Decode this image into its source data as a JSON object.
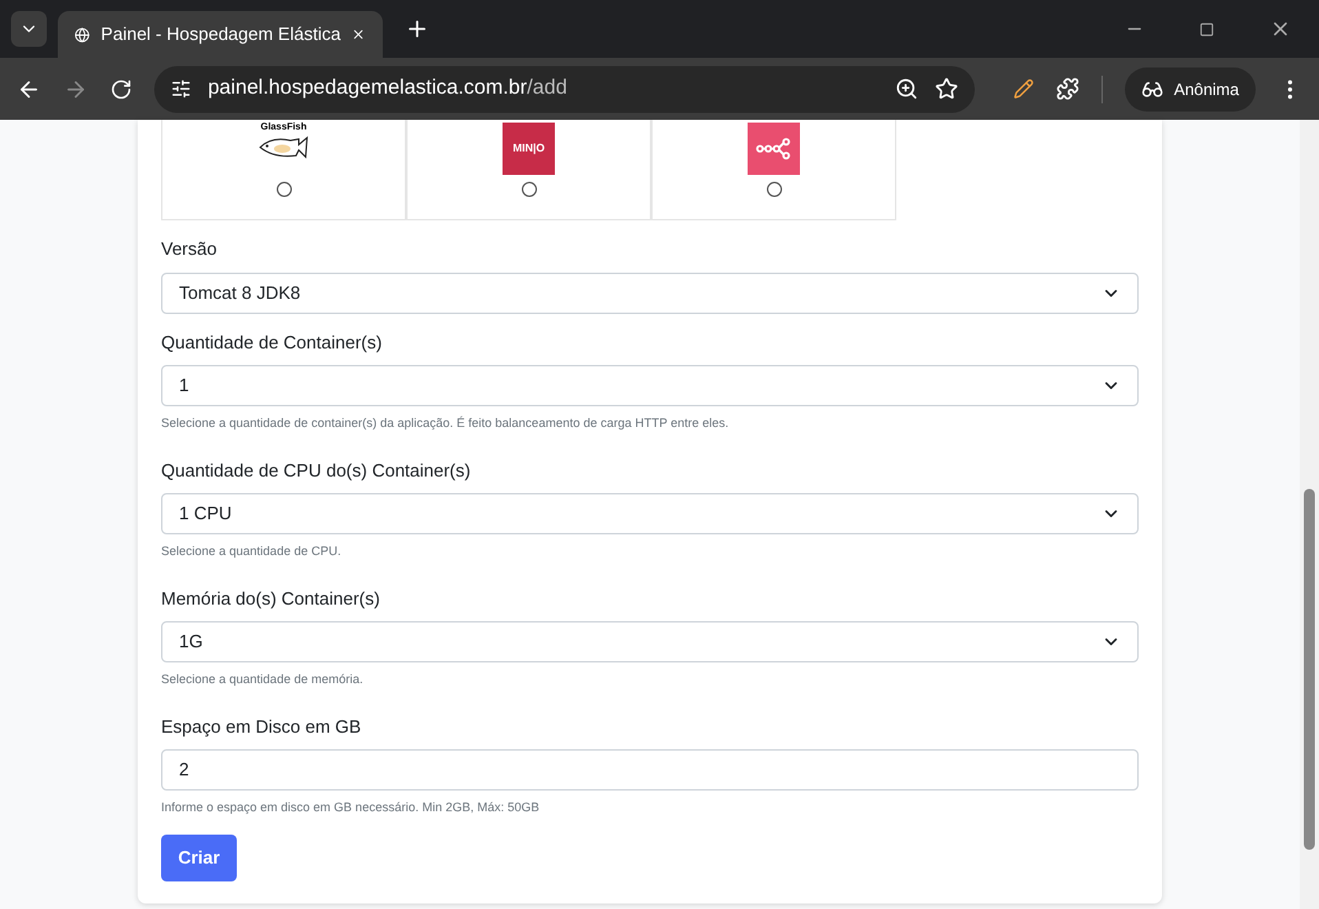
{
  "browser": {
    "tab_title": "Painel - Hospedagem Elástica",
    "url_host": "painel.hospedagemelastica.com.br",
    "url_path": "/add",
    "profile": "Anônima"
  },
  "options": [
    {
      "kind": "glassfish",
      "logo_text": "GlassFish",
      "selected": false
    },
    {
      "kind": "minio",
      "logo_text": "MIN|O",
      "selected": false
    },
    {
      "kind": "nodes",
      "selected": false
    }
  ],
  "fields": [
    {
      "kind": "select",
      "label": "Versão",
      "value": "Tomcat 8 JDK8"
    },
    {
      "kind": "select",
      "label": "Quantidade de Container(s)",
      "value": "1",
      "help": "Selecione a quantidade de container(s) da aplicação. É feito balanceamento de carga HTTP entre eles."
    },
    {
      "kind": "select",
      "label": "Quantidade de CPU do(s) Container(s)",
      "value": "1 CPU",
      "help": "Selecione a quantidade de CPU."
    },
    {
      "kind": "select",
      "label": "Memória do(s) Container(s)",
      "value": "1G",
      "help": "Selecione a quantidade de memória."
    },
    {
      "kind": "input",
      "label": "Espaço em Disco em GB",
      "value": "2",
      "help": "Informe o espaço em disco em GB necessário. Min 2GB, Máx: 50GB"
    }
  ],
  "submit": "Criar"
}
